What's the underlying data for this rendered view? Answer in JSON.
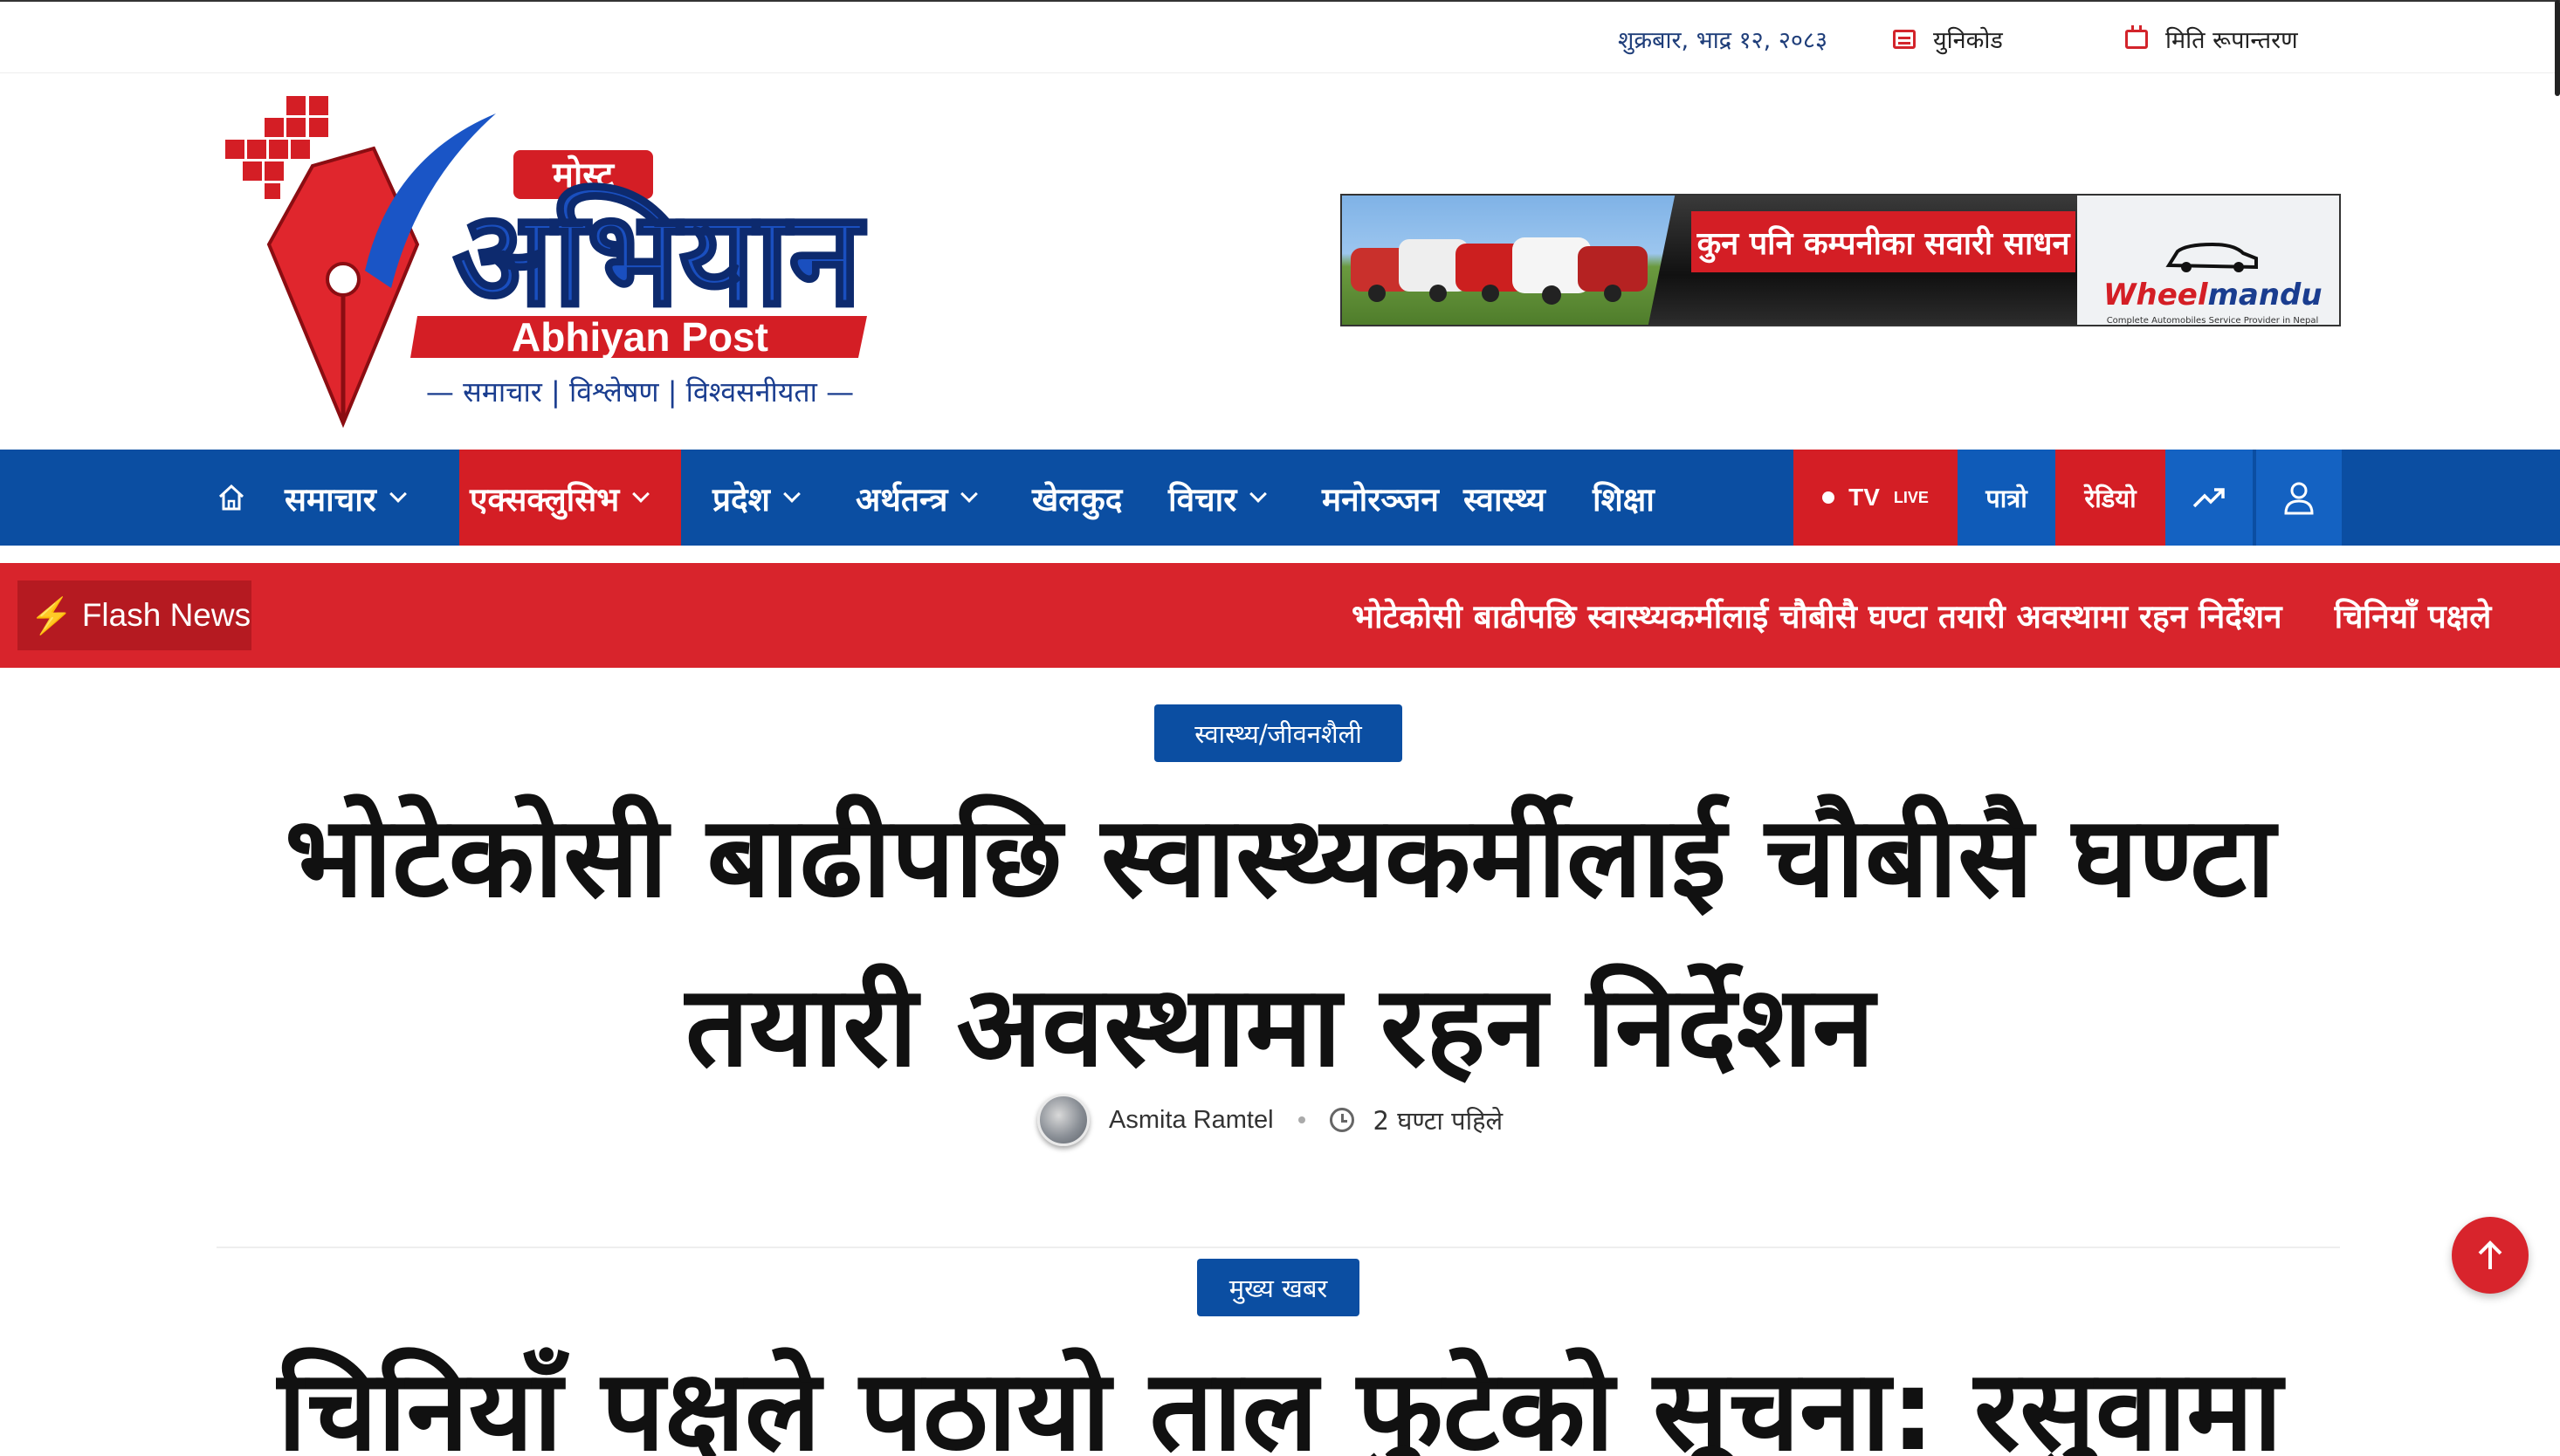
{
  "topbar": {
    "date": "शुक्रबार, भाद्र १२, २०८३",
    "unicode_label": "युनिकोड",
    "date_convert_label": "मिति रूपान्तरण"
  },
  "logo": {
    "top_text": "मोस्ट",
    "main_text": "अभियान",
    "english_text": "Abhiyan Post",
    "tagline": "— समाचार | विश्लेषण | विश्वसनीयता —"
  },
  "banner": {
    "slogan": "कुन पनि कम्पनीका सवारी साधन",
    "brand_part1": "Wheel",
    "brand_part2": "mandu",
    "brand_sub": "Complete Automobiles Service Provider in Nepal"
  },
  "nav": {
    "items": [
      {
        "label": "समाचार",
        "has_dropdown": true
      },
      {
        "label": "एक्सक्लुसिभ",
        "has_dropdown": true,
        "active": true
      },
      {
        "label": "प्रदेश",
        "has_dropdown": true
      },
      {
        "label": "अर्थतन्त्र",
        "has_dropdown": true
      },
      {
        "label": "खेलकुद",
        "has_dropdown": false
      },
      {
        "label": "विचार",
        "has_dropdown": true
      },
      {
        "label": "मनोरञ्जन",
        "has_dropdown": false
      },
      {
        "label": "स्वास्थ्य",
        "has_dropdown": false
      },
      {
        "label": "शिक्षा",
        "has_dropdown": false
      }
    ],
    "tv_label": "TV",
    "live_label": "LIVE",
    "patro_label": "पात्रो",
    "radio_label": "रेडियो"
  },
  "flash": {
    "label": "Flash News",
    "headlines": [
      "भोटेकोसी बाढीपछि स्वास्थ्यकर्मीलाई चौबीसै घण्टा तयारी अवस्थामा रहन निर्देशन",
      "चिनियाँ पक्षले"
    ]
  },
  "article1": {
    "category": "स्वास्थ्य/जीवनशैली",
    "title_line1": "भोटेकोसी बाढीपछि स्वास्थ्यकर्मीलाई चौबीसै घण्टा",
    "title_line2": "तयारी अवस्थामा रहन निर्देशन",
    "author": "Asmita Ramtel",
    "time": "2 घण्टा पहिले"
  },
  "article2": {
    "category": "मुख्य खबर",
    "title_line1": "चिनियाँ पक्षले पठायो ताल फुटेको सूचना: रसुवामा"
  },
  "colors": {
    "nav_blue": "#0b4ea2",
    "accent_red": "#d8242c"
  }
}
